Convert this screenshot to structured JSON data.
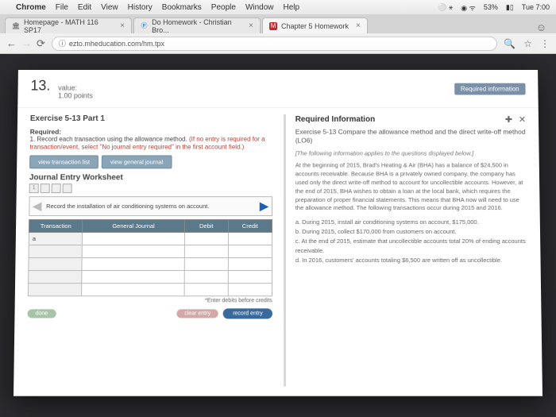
{
  "menubar": {
    "app": "Chrome",
    "items": [
      "File",
      "Edit",
      "View",
      "History",
      "Bookmarks",
      "People",
      "Window",
      "Help"
    ],
    "battery": "53%",
    "time": "Tue 7:00"
  },
  "tabs": [
    {
      "label": "Homepage - MATH 116 SP17"
    },
    {
      "label": "Do Homework - Christian Bro..."
    },
    {
      "label": "Chapter 5 Homework"
    }
  ],
  "url": "ezto.mheducation.com/hm.tpx",
  "question": {
    "number": "13.",
    "value_label": "value:",
    "points": "1.00 points",
    "req_info_btn": "Required information"
  },
  "exercise": {
    "title": "Exercise 5-13 Part 1",
    "required_label": "Required:",
    "required_text": "1. Record each transaction using the allowance method. ",
    "required_red": "(If no entry is required for a transaction/event, select \"No journal entry required\" in the first account field.)",
    "view_trans": "view transaction list",
    "view_journal": "view general journal",
    "worksheet_title": "Journal Entry Worksheet",
    "instruction": "Record the installation of air conditioning systems on account.",
    "th": {
      "trans": "Transaction",
      "gj": "General Journal",
      "debit": "Debit",
      "credit": "Credit"
    },
    "row_label": "a",
    "hint": "*Enter debits before credits",
    "done": "done",
    "clear": "clear entry",
    "record": "record entry"
  },
  "info": {
    "title": "Required Information",
    "subtitle": "Exercise 5-13 Compare the allowance method and the direct write-off method (LO6)",
    "note": "[The following information applies to the questions displayed below.]",
    "body": "At the beginning of 2015, Brad's Heating & Air (BHA) has a balance of $24,500 in accounts receivable. Because BHA is a privately owned company, the company has used only the direct write-off method to account for uncollectible accounts. However, at the end of 2015, BHA wishes to obtain a loan at the local bank, which requires the preparation of proper financial statements. This means that BHA now will need to use the allowance method. The following transactions occur during 2015 and 2016.",
    "list": {
      "a": "a. During 2015, install air conditioning systems on account, $175,000.",
      "b": "b. During 2015, collect $170,000 from customers on account.",
      "c": "c. At the end of 2015, estimate that uncollectible accounts total 20% of ending accounts receivable.",
      "d": "d. In 2016, customers' accounts totaling $6,500 are written off as uncollectible."
    }
  }
}
